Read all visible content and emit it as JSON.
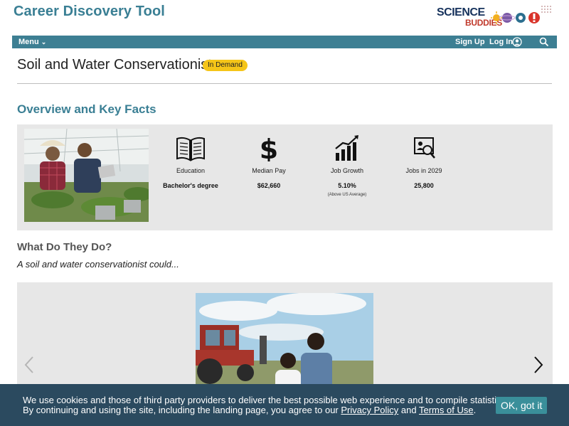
{
  "header": {
    "site_title": "Career Discovery Tool",
    "logo_line1": "SCIENCE",
    "logo_line2": "BUDDIES"
  },
  "nav": {
    "menu_label": "Menu",
    "menu_caret": "⌄",
    "signup_label": "Sign Up",
    "login_label": "Log In"
  },
  "career": {
    "title": "Soil and Water Conservationist",
    "badge": "In Demand"
  },
  "overview": {
    "heading": "Overview and Key Facts",
    "photo": "farmers-greenhouse-photo",
    "facts": [
      {
        "icon": "book-icon",
        "label": "Education",
        "value": "Bachelor's degree",
        "note": ""
      },
      {
        "icon": "dollar-icon",
        "label": "Median Pay",
        "value": "$62,660",
        "note": ""
      },
      {
        "icon": "growth-chart-icon",
        "label": "Job Growth",
        "value": "5.10%",
        "note": "(Above US Average)"
      },
      {
        "icon": "job-search-icon",
        "label": "Jobs in 2029",
        "value": "25,800",
        "note": ""
      }
    ]
  },
  "what_they_do": {
    "heading": "What Do They Do?",
    "subheading": "A soil and water conservationist could...",
    "carousel_photo": "couple-tractor-field-photo"
  },
  "cookie": {
    "line1": "We use cookies and those of third party providers to deliver the best possible web experience and to compile statistics.",
    "line2_pre": "By continuing and using the site, including the landing page, you agree to our ",
    "privacy_link": "Privacy Policy",
    "and_text": " and ",
    "terms_link": "Terms of Use",
    "period": ".",
    "ok_label": "OK, got it"
  },
  "colors": {
    "brand": "#3a7f94",
    "nav_bg": "#3d7f93",
    "badge": "#f5c518",
    "cookie_bg": "#2b4a5f",
    "ok_button": "#3a8f9a"
  }
}
